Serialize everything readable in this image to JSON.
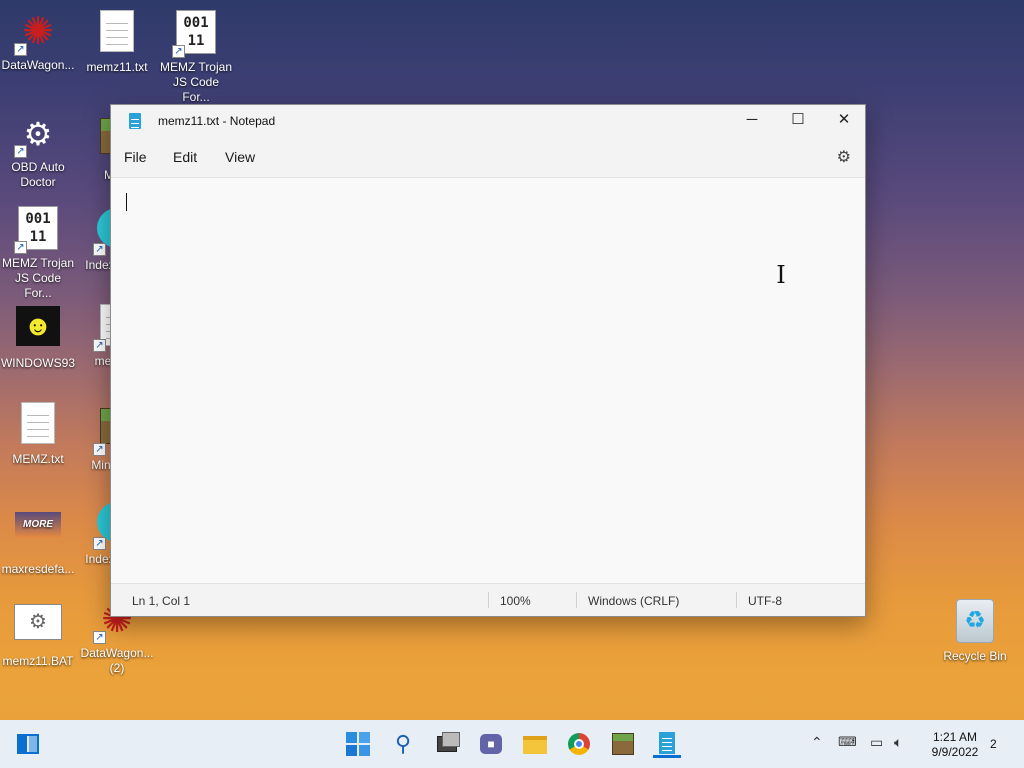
{
  "desktop": {
    "icons": [
      {
        "label": "DataWagon...",
        "icon": "web-icon"
      },
      {
        "label": "memz11.txt",
        "icon": "text-file-icon"
      },
      {
        "label": "MEMZ Trojan JS Code For...",
        "icon": "binary-file-icon"
      },
      {
        "label": "OBD Auto Doctor",
        "icon": "car-engine-icon"
      },
      {
        "label": "Mine",
        "icon": "minecraft-icon"
      },
      {
        "label": "MEMZ Trojan JS Code For...",
        "icon": "binary-file-icon"
      },
      {
        "label": "Index Being",
        "icon": "app-icon"
      },
      {
        "label": "WINDOWS93",
        "icon": "windows93-icon"
      },
      {
        "label": "mem Sh",
        "icon": "text-file-icon"
      },
      {
        "label": "MEMZ.txt",
        "icon": "text-file-icon"
      },
      {
        "label": "Mine - Sh",
        "icon": "minecraft-icon"
      },
      {
        "label": "maxresdefa...",
        "icon": "image-icon"
      },
      {
        "label": "Index Being",
        "icon": "app-icon"
      },
      {
        "label": "memz11.BAT",
        "icon": "batch-file-icon"
      },
      {
        "label": "DataWagon... (2)",
        "icon": "web-icon"
      },
      {
        "label": "Recycle Bin",
        "icon": "recycle-bin-icon"
      }
    ]
  },
  "notepad": {
    "title": "memz11.txt - Notepad",
    "menu": [
      "File",
      "Edit",
      "View"
    ],
    "content": "",
    "status": {
      "position": "Ln 1, Col 1",
      "zoom": "100%",
      "line_ending": "Windows (CRLF)",
      "encoding": "UTF-8"
    }
  },
  "taskbar": {
    "clock_time": "1:21 AM",
    "clock_date": "9/9/2022",
    "notifications": "2"
  },
  "colors": {
    "accent": "#0a6fd1",
    "taskbar": "#e7eef6"
  }
}
